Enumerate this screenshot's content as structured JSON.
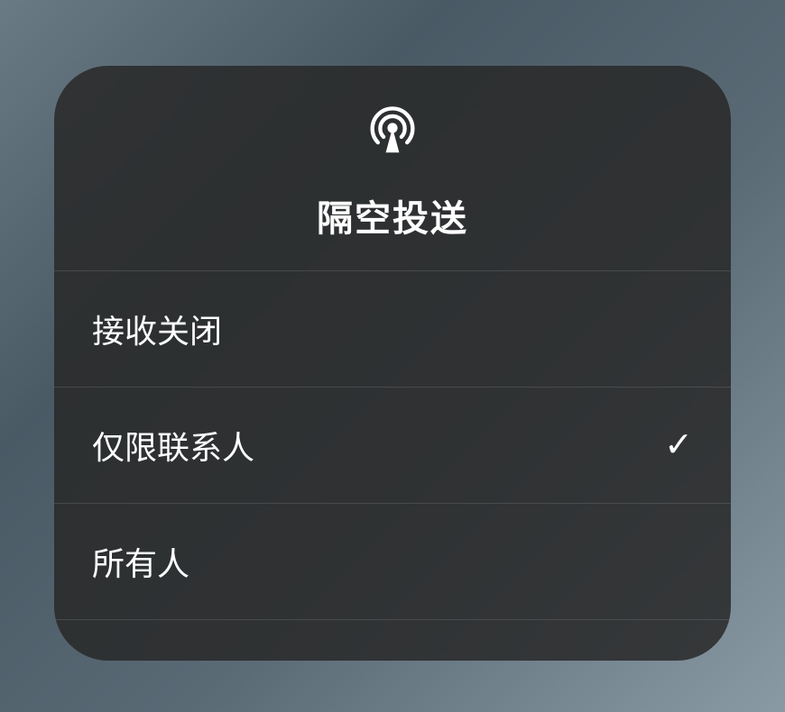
{
  "title": "隔空投送",
  "options": [
    {
      "label": "接收关闭",
      "selected": false
    },
    {
      "label": "仅限联系人",
      "selected": true
    },
    {
      "label": "所有人",
      "selected": false
    }
  ]
}
